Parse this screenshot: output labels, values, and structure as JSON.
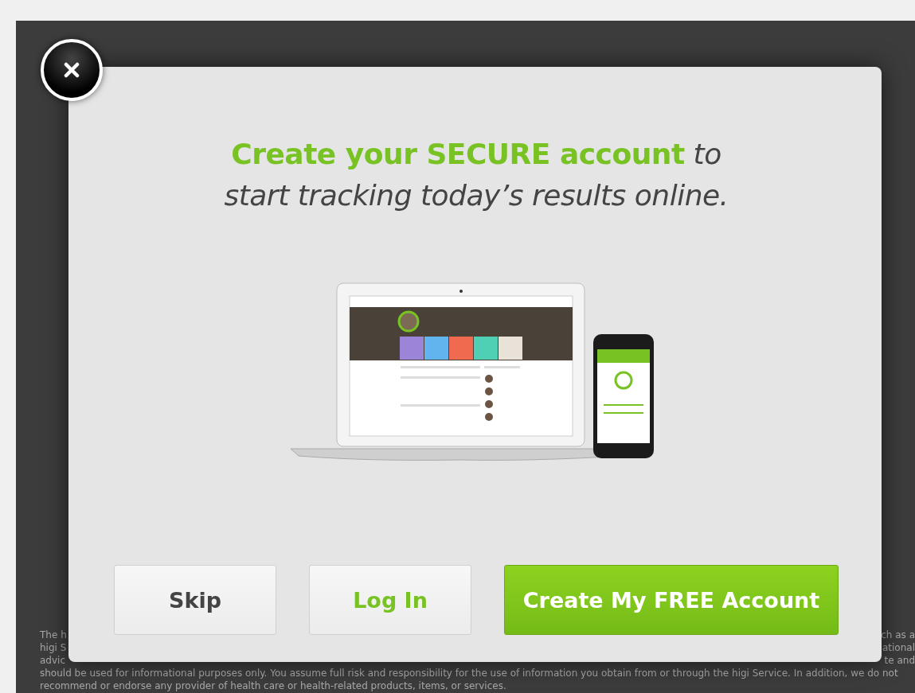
{
  "dialog": {
    "headline": "**Create your SECURE account** to start tracking today’s results online.",
    "buttons": [
      {
        "label": "Skip",
        "kind": "secondary"
      },
      {
        "label": "Log In",
        "kind": "link"
      },
      {
        "label": "Create My FREE Account",
        "kind": "primary"
      }
    ]
  },
  "background": {
    "disclaimer_lines": [
      {
        "left": "The h",
        "right": "ch as a"
      },
      {
        "left": "higi S",
        "right": "ational"
      },
      {
        "left": "advic",
        "right": "te and"
      },
      {
        "left": "should be used for informational purposes only. You assume full risk and responsibility for the use of information you obtain from or through the higi Service. In addition, we do not"
      },
      {
        "left": "recommend or endorse any provider of health care or health-related products, items, or services."
      }
    ]
  }
}
